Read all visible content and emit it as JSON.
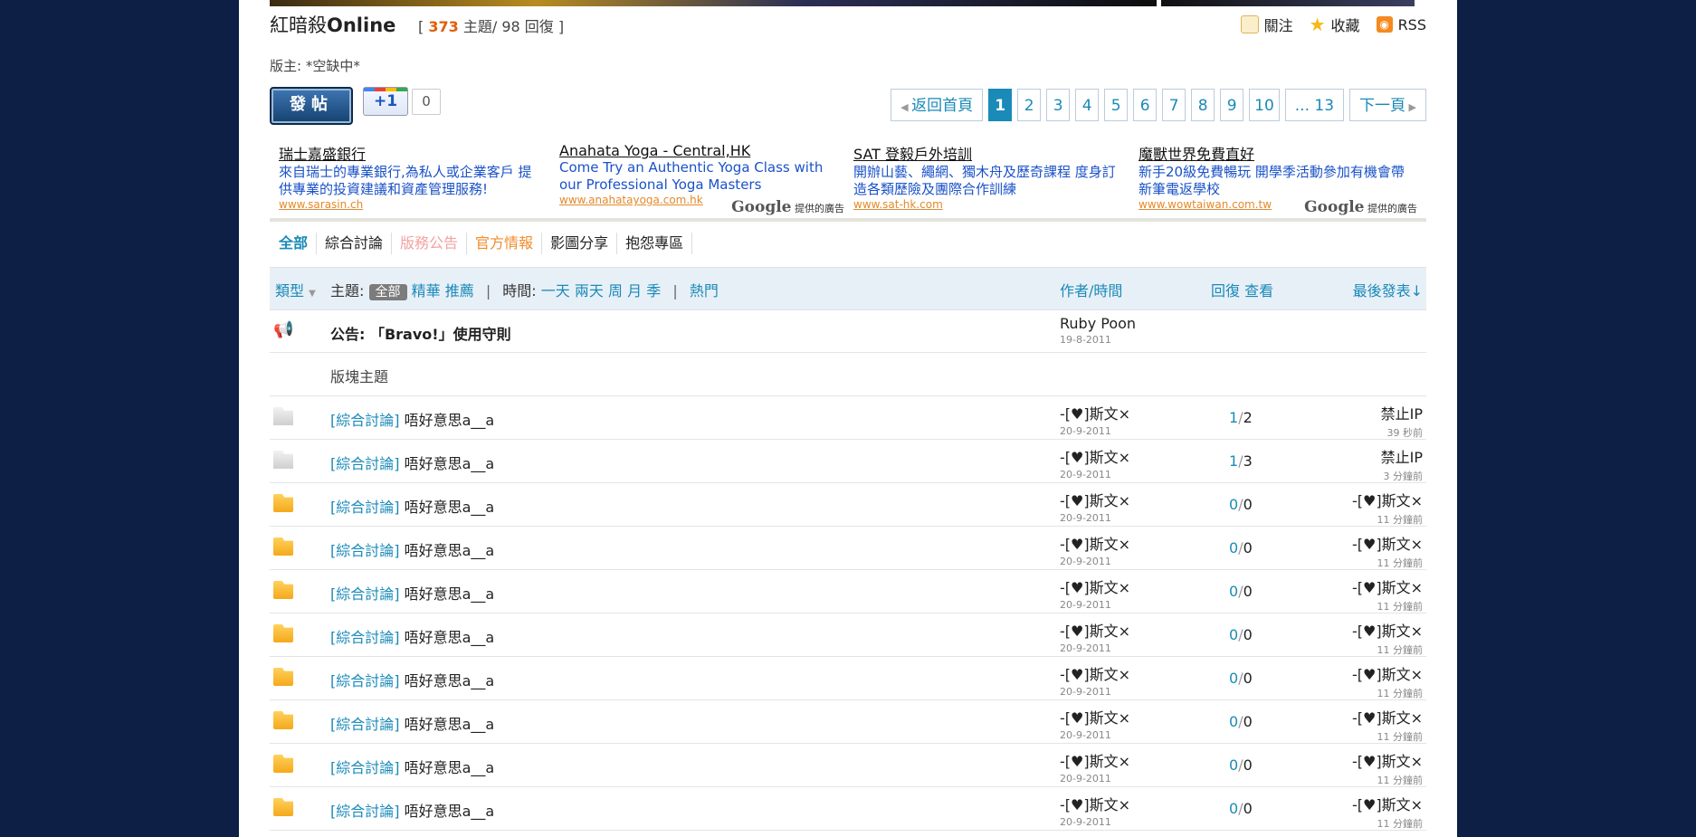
{
  "header": {
    "forum_name": "紅暗殺",
    "forum_name_bold": "Online",
    "topics_count": "373",
    "topics_label": "主題",
    "replies_count": "98",
    "replies_label": "回復",
    "follow": "關注",
    "favorite": "收藏",
    "rss": "RSS",
    "moderator": "版主: *空缺中*"
  },
  "toolbar": {
    "post_label": "發帖",
    "plusone_label": "+1",
    "plusone_count": "0"
  },
  "pager": {
    "back": "返回首頁",
    "pages": [
      "1",
      "2",
      "3",
      "4",
      "5",
      "6",
      "7",
      "8",
      "9",
      "10"
    ],
    "last": "... 13",
    "next": "下一頁"
  },
  "ads": [
    {
      "title": "瑞士嘉盛銀行",
      "desc": "來自瑞士的專業銀行,為私人或企業客戶 提供專業的投資建議和資產管理服務!",
      "url": "www.sarasin.ch"
    },
    {
      "title": "Anahata Yoga - Central,HK",
      "desc": "Come Try an Authentic Yoga Class with our Professional Yoga Masters",
      "url": "www.anahatayoga.com.hk"
    },
    {
      "title": "SAT 登毅戶外培訓",
      "desc": "開辦山藝、繩網、獨木舟及歷奇課程 度身訂造各類歷險及團際合作訓練",
      "url": "www.sat-hk.com"
    },
    {
      "title": "魔獸世界免費直好",
      "desc": "新手20級免費暢玩 開學季活動參加有機會帶新筆電返學校",
      "url": "www.wowtaiwan.com.tw"
    }
  ],
  "google_ad": {
    "brand": "Google",
    "suffix": "提供的廣告"
  },
  "categories": {
    "all": "全部",
    "general": "綜合討論",
    "service": "版務公告",
    "official": "官方情報",
    "media": "影圖分享",
    "complaint": "抱怨專區"
  },
  "table_head": {
    "type": "類型",
    "subject_label": "主題:",
    "all": "全部",
    "elite": "精華",
    "recommend": "推薦",
    "time_label": "時間:",
    "one_day": "一天",
    "two_days": "兩天",
    "week": "周",
    "month": "月",
    "season": "季",
    "hot": "熱門",
    "author_time": "作者/時間",
    "reply_view": "回復 查看",
    "last_post": "最後發表"
  },
  "announcement": {
    "subject": "公告: 「Bravo!」使用守則",
    "author": "Ruby Poon",
    "date": "19-8-2011"
  },
  "section_label": "版塊主題",
  "threads": [
    {
      "tag": "[綜合討論]",
      "title": "唔好意思a__a",
      "author": "-[♥]斯文×",
      "date": "20-9-2011",
      "replies": "1",
      "views": "2",
      "last_user": "禁止IP",
      "last_time": "39 秒前",
      "icon": "grey"
    },
    {
      "tag": "[綜合討論]",
      "title": "唔好意思a__a",
      "author": "-[♥]斯文×",
      "date": "20-9-2011",
      "replies": "1",
      "views": "3",
      "last_user": "禁止IP",
      "last_time": "3 分鐘前",
      "icon": "grey"
    },
    {
      "tag": "[綜合討論]",
      "title": "唔好意思a__a",
      "author": "-[♥]斯文×",
      "date": "20-9-2011",
      "replies": "0",
      "views": "0",
      "last_user": "-[♥]斯文×",
      "last_time": "11 分鐘前",
      "icon": "yellow"
    },
    {
      "tag": "[綜合討論]",
      "title": "唔好意思a__a",
      "author": "-[♥]斯文×",
      "date": "20-9-2011",
      "replies": "0",
      "views": "0",
      "last_user": "-[♥]斯文×",
      "last_time": "11 分鐘前",
      "icon": "yellow"
    },
    {
      "tag": "[綜合討論]",
      "title": "唔好意思a__a",
      "author": "-[♥]斯文×",
      "date": "20-9-2011",
      "replies": "0",
      "views": "0",
      "last_user": "-[♥]斯文×",
      "last_time": "11 分鐘前",
      "icon": "yellow"
    },
    {
      "tag": "[綜合討論]",
      "title": "唔好意思a__a",
      "author": "-[♥]斯文×",
      "date": "20-9-2011",
      "replies": "0",
      "views": "0",
      "last_user": "-[♥]斯文×",
      "last_time": "11 分鐘前",
      "icon": "yellow"
    },
    {
      "tag": "[綜合討論]",
      "title": "唔好意思a__a",
      "author": "-[♥]斯文×",
      "date": "20-9-2011",
      "replies": "0",
      "views": "0",
      "last_user": "-[♥]斯文×",
      "last_time": "11 分鐘前",
      "icon": "yellow"
    },
    {
      "tag": "[綜合討論]",
      "title": "唔好意思a__a",
      "author": "-[♥]斯文×",
      "date": "20-9-2011",
      "replies": "0",
      "views": "0",
      "last_user": "-[♥]斯文×",
      "last_time": "11 分鐘前",
      "icon": "yellow"
    },
    {
      "tag": "[綜合討論]",
      "title": "唔好意思a__a",
      "author": "-[♥]斯文×",
      "date": "20-9-2011",
      "replies": "0",
      "views": "0",
      "last_user": "-[♥]斯文×",
      "last_time": "11 分鐘前",
      "icon": "yellow"
    },
    {
      "tag": "[綜合討論]",
      "title": "唔好意思a__a",
      "author": "-[♥]斯文×",
      "date": "20-9-2011",
      "replies": "0",
      "views": "0",
      "last_user": "-[♥]斯文×",
      "last_time": "11 分鐘前",
      "icon": "yellow"
    }
  ],
  "colors": {
    "accent": "#1a8ab8",
    "orange": "#e25d07",
    "background": "#0e1f45"
  }
}
